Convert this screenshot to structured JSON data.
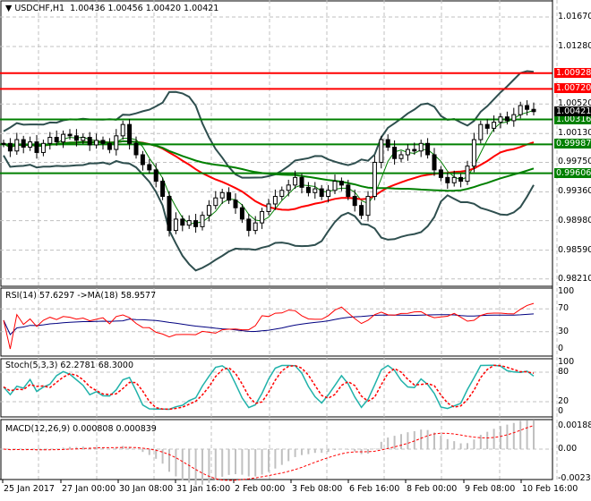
{
  "header": {
    "symbol": "USDCHF,H1",
    "ohlc": "1.00436 1.00456 1.00420 1.00421"
  },
  "chart_data": {
    "type": "candlestick",
    "title": "USDCHF,H1 1.00436 1.00456 1.00420 1.00421",
    "ylim": [
      0.9821,
      1.0186
    ],
    "price_ticks": [
      "1.01670",
      "1.01280",
      "1.00520",
      "1.00130",
      "0.99750",
      "0.99360",
      "0.98980",
      "0.98590",
      "0.98210"
    ],
    "time_ticks": [
      "25 Jan 2017",
      "27 Jan 00:00",
      "30 Jan 08:00",
      "31 Jan 16:00",
      "2 Feb 00:00",
      "3 Feb 08:00",
      "6 Feb 16:00",
      "8 Feb 00:00",
      "9 Feb 08:00",
      "10 Feb 16:00"
    ],
    "close": [
      1.0,
      0.999,
      1.0005,
      0.9995,
      1.0002,
      0.9988,
      1.0,
      1.0008,
      1.0002,
      1.0012,
      1.001,
      1.0004,
      1.0008,
      0.9998,
      1.0004,
      1.0,
      0.9992,
      1.001,
      1.0025,
      1.0,
      0.9985,
      0.9972,
      0.9965,
      0.995,
      0.993,
      0.9885,
      0.99,
      0.9892,
      0.9898,
      0.989,
      0.9905,
      0.9918,
      0.9928,
      0.9935,
      0.9925,
      0.9915,
      0.99,
      0.9885,
      0.9895,
      0.991,
      0.992,
      0.993,
      0.9938,
      0.9945,
      0.9955,
      0.9942,
      0.9935,
      0.994,
      0.993,
      0.9938,
      0.995,
      0.9945,
      0.993,
      0.9918,
      0.9905,
      0.993,
      0.9975,
      1.0005,
      0.9995,
      0.998,
      0.9985,
      0.9992,
      0.999,
      1.0,
      0.9985,
      0.9965,
      0.9955,
      0.9948,
      0.9955,
      0.995,
      0.997,
      1.0005,
      1.0025,
      1.002,
      1.0028,
      1.0035,
      1.003,
      1.0038,
      1.005,
      1.0045,
      1.0042
    ],
    "levels": [
      {
        "label": "1.00928",
        "value": 1.00928,
        "color": "#ff0000"
      },
      {
        "label": "1.00720",
        "value": 1.0072,
        "color": "#ff0000"
      },
      {
        "label": "1.00316",
        "value": 1.00316,
        "color": "#008000"
      },
      {
        "label": "0.99987",
        "value": 0.99987,
        "color": "#008000"
      },
      {
        "label": "0.99606",
        "value": 0.99606,
        "color": "#008000"
      }
    ],
    "current_price": "1.00421",
    "indicators": {
      "rsi": {
        "title": "RSI(14) 57.6297  ->MA(18) 58.9577",
        "ticks": [
          "100",
          "70",
          "30",
          "0"
        ]
      },
      "stoch": {
        "title": "Stoch(5,3,3) 62.2781 68.3000",
        "ticks": [
          "100",
          "80",
          "20",
          "0"
        ]
      },
      "macd": {
        "title": "MACD(12,26,9) 0.000808 0.000839",
        "ticks": [
          "0.001882",
          "0.00",
          "-0.002356"
        ]
      }
    },
    "colors": {
      "bull": "#000000",
      "red_ma": "#ff0000",
      "green_ma": "#008000",
      "bands": "#2f4f4f",
      "rsi": "#ff0000",
      "rsi_ma": "#000080",
      "stoch_main": "#20b2aa",
      "stoch_signal": "#ff0000",
      "macd_hist": "#c0c0c0"
    }
  }
}
